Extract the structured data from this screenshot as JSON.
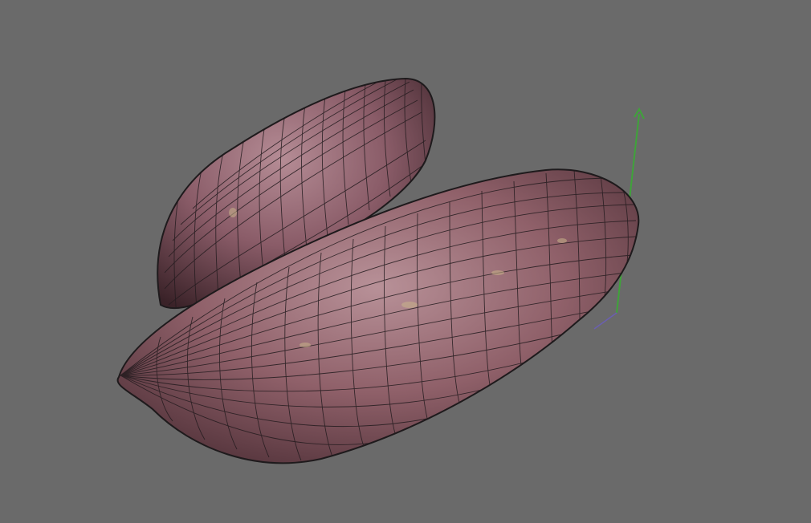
{
  "viewport": {
    "background": "#6a6a6a",
    "render_mode": "textured-wireframe",
    "objects": [
      {
        "name": "sweet-potato-back",
        "texture_color": "#8a5c68",
        "wire_color": "#1f1a1c"
      },
      {
        "name": "sweet-potato-front",
        "texture_color": "#8f6069",
        "wire_color": "#1f1a1c"
      }
    ],
    "gizmo": {
      "axes": [
        {
          "name": "y-axis",
          "color": "#3fa33a"
        },
        {
          "name": "x-axis",
          "color": "#6a5fb0"
        }
      ]
    }
  }
}
